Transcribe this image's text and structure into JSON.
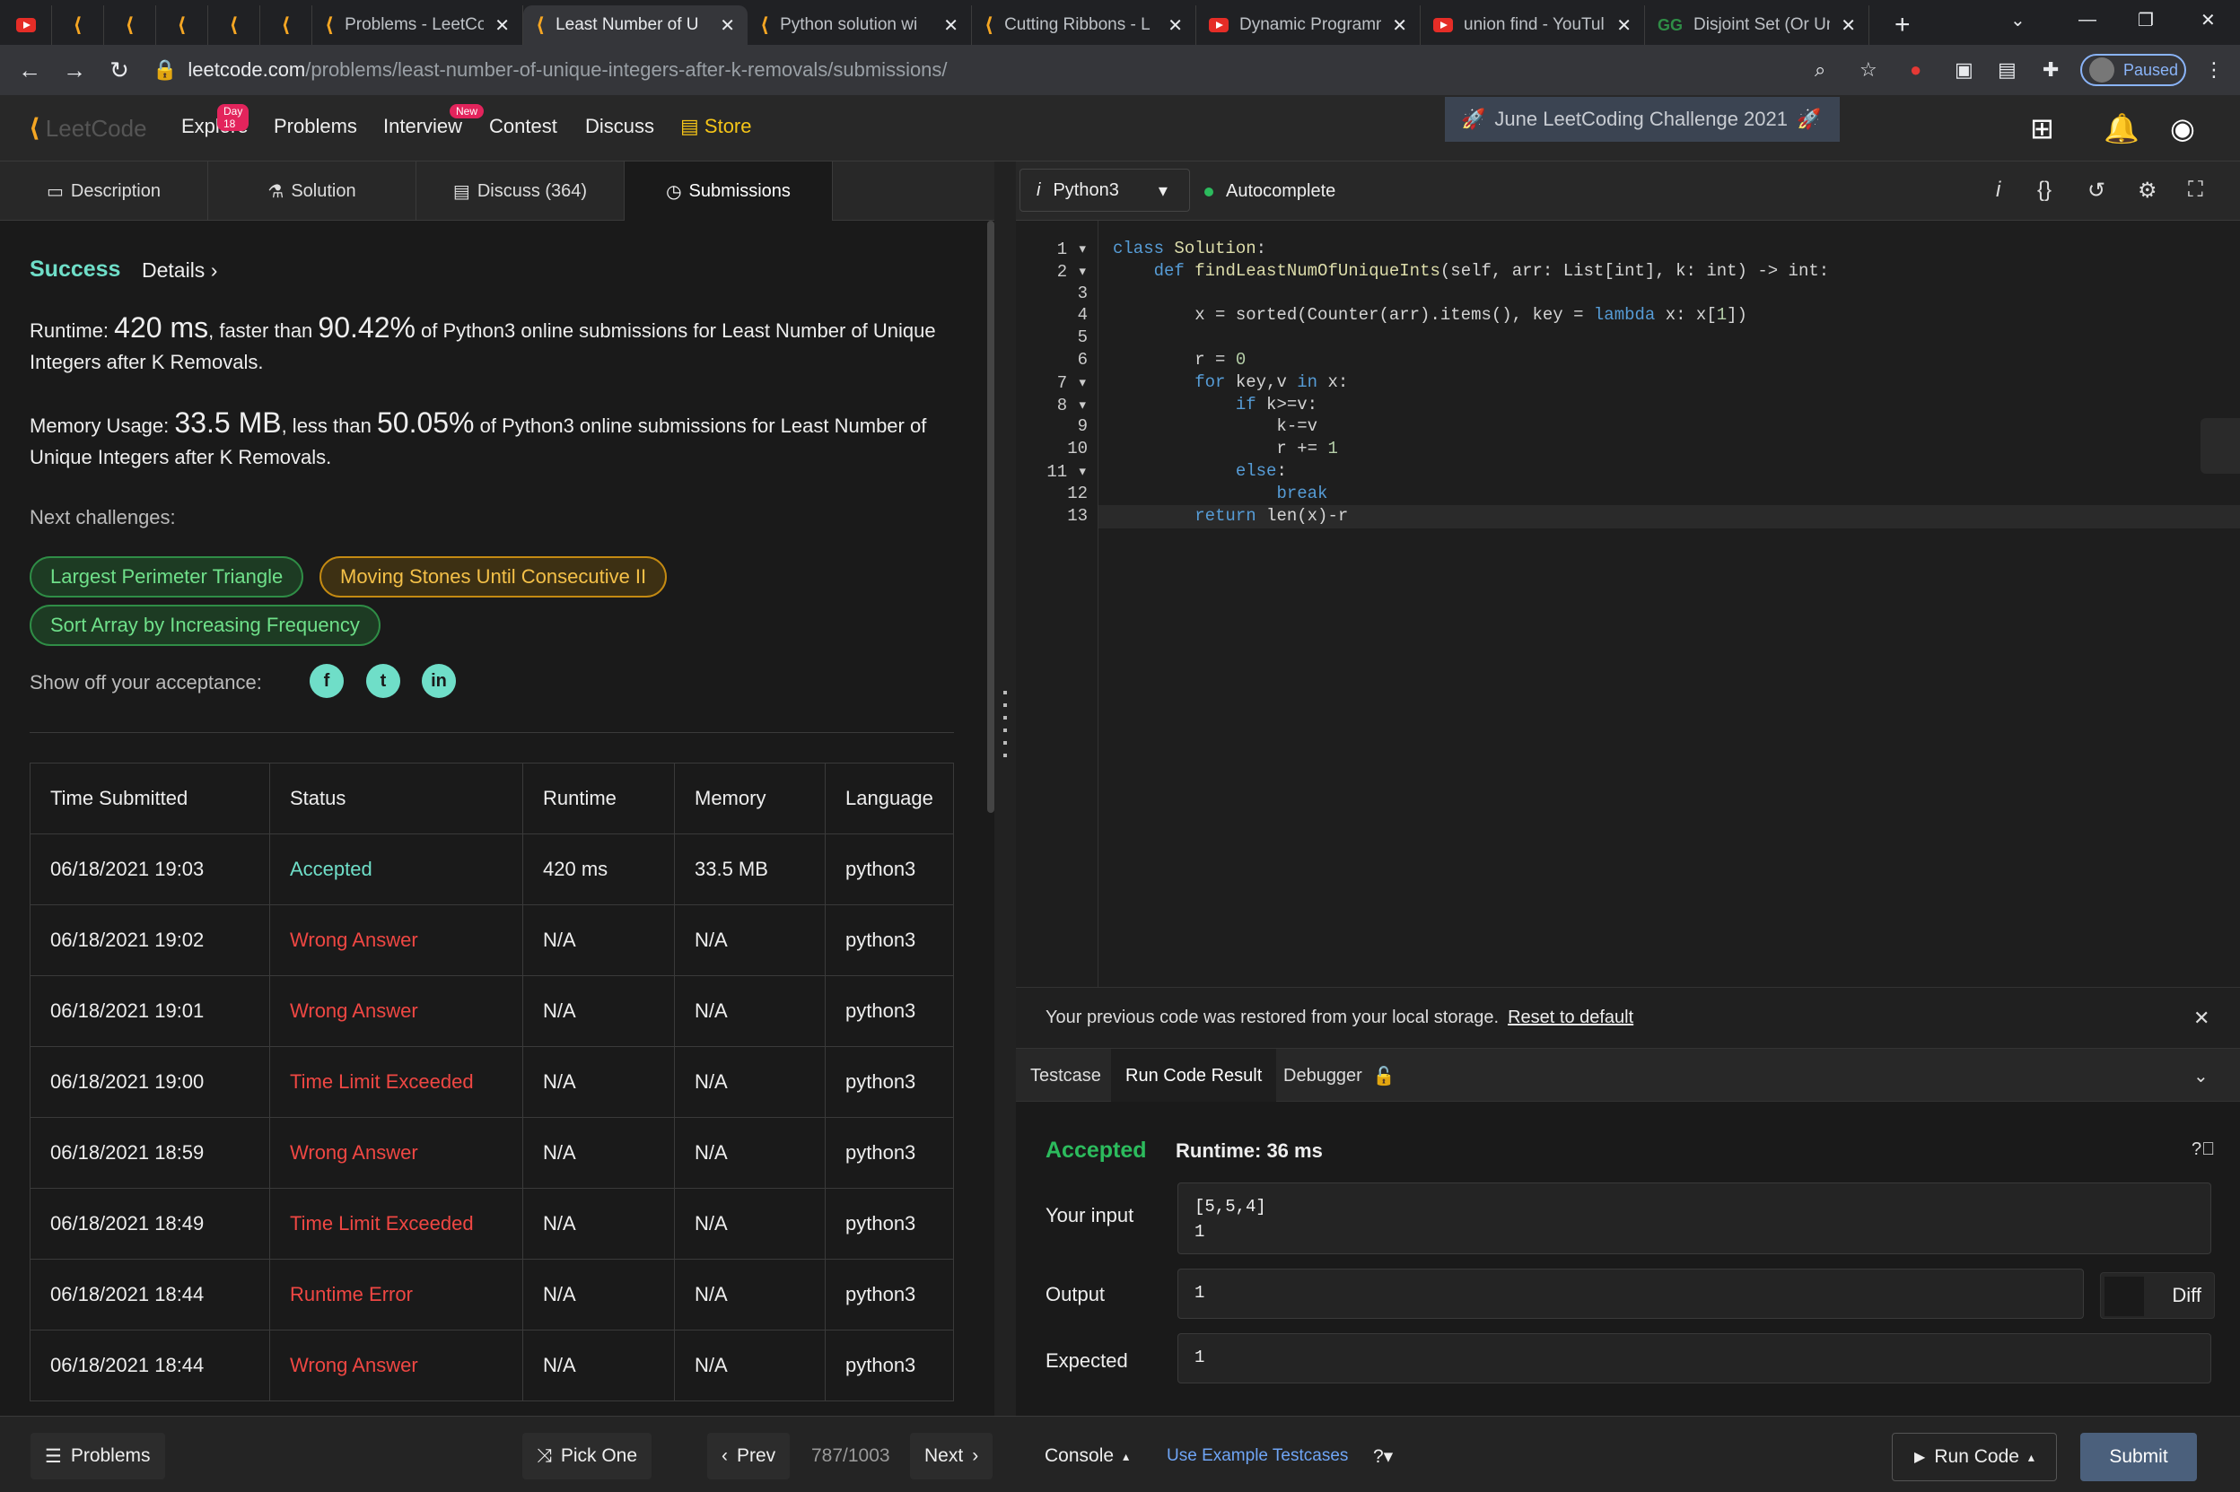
{
  "browser": {
    "tabs": [
      {
        "title": "",
        "favicon": "leetcode-icon"
      },
      {
        "title": "",
        "favicon": "leetcode-icon"
      },
      {
        "title": "",
        "favicon": "leetcode-icon"
      },
      {
        "title": "",
        "favicon": "leetcode-icon"
      },
      {
        "title": "",
        "favicon": "leetcode-icon"
      },
      {
        "title": "Problems - LeetCo",
        "favicon": "leetcode-icon"
      },
      {
        "title": "Least Number of U",
        "favicon": "leetcode-icon",
        "active": true
      },
      {
        "title": "Python solution wi",
        "favicon": "leetcode-icon"
      },
      {
        "title": "Cutting Ribbons - L",
        "favicon": "leetcode-icon"
      },
      {
        "title": "Dynamic Programm",
        "favicon": "youtube-icon"
      },
      {
        "title": "union find - YouTul",
        "favicon": "youtube-icon"
      },
      {
        "title": "Disjoint Set (Or Uni",
        "favicon": "geeksforgeeks-icon"
      }
    ],
    "url_domain": "leetcode.com",
    "url_path": "/problems/least-number-of-unique-integers-after-k-removals/submissions/",
    "profile_status": "Paused"
  },
  "nav": {
    "logo": "LeetCode",
    "explore": "Explore",
    "explore_badge": "Day 18",
    "problems": "Problems",
    "interview": "Interview",
    "interview_badge": "New",
    "contest": "Contest",
    "discuss": "Discuss",
    "store": "Store",
    "challenge": "June LeetCoding Challenge 2021"
  },
  "panel_tabs": {
    "description": "Description",
    "solution": "Solution",
    "discuss": "Discuss (364)",
    "submissions": "Submissions"
  },
  "summary": {
    "status": "Success",
    "details": "Details",
    "runtime_label": "Runtime:",
    "runtime_value": "420 ms",
    "runtime_mid": ", faster than ",
    "runtime_pct": "90.42%",
    "runtime_tail": " of Python3 online submissions for Least Number of Unique Integers after K Removals.",
    "memory_label": "Memory Usage:",
    "memory_value": "33.5 MB",
    "memory_mid": ", less than ",
    "memory_pct": "50.05%",
    "memory_tail": " of Python3 online submissions for Least Number of Unique Integers after K Removals.",
    "next_label": "Next challenges:",
    "challenges": [
      "Largest Perimeter Triangle",
      "Moving Stones Until Consecutive II",
      "Sort Array by Increasing Frequency"
    ],
    "show_off": "Show off your acceptance:"
  },
  "table": {
    "headers": [
      "Time Submitted",
      "Status",
      "Runtime",
      "Memory",
      "Language"
    ],
    "rows": [
      [
        "06/18/2021 19:03",
        "Accepted",
        "420 ms",
        "33.5 MB",
        "python3"
      ],
      [
        "06/18/2021 19:02",
        "Wrong Answer",
        "N/A",
        "N/A",
        "python3"
      ],
      [
        "06/18/2021 19:01",
        "Wrong Answer",
        "N/A",
        "N/A",
        "python3"
      ],
      [
        "06/18/2021 19:00",
        "Time Limit Exceeded",
        "N/A",
        "N/A",
        "python3"
      ],
      [
        "06/18/2021 18:59",
        "Wrong Answer",
        "N/A",
        "N/A",
        "python3"
      ],
      [
        "06/18/2021 18:49",
        "Time Limit Exceeded",
        "N/A",
        "N/A",
        "python3"
      ],
      [
        "06/18/2021 18:44",
        "Runtime Error",
        "N/A",
        "N/A",
        "python3"
      ],
      [
        "06/18/2021 18:44",
        "Wrong Answer",
        "N/A",
        "N/A",
        "python3"
      ]
    ]
  },
  "editor": {
    "language": "Python3",
    "autocomplete": "Autocomplete",
    "code": [
      "class Solution:",
      "    def findLeastNumOfUniqueInts(self, arr: List[int], k: int) -> int:",
      "",
      "        x = sorted(Counter(arr).items(), key = lambda x: x[1])",
      "",
      "        r = 0",
      "        for key,v in x:",
      "            if k>=v:",
      "                k-=v",
      "                r += 1",
      "            else:",
      "                break",
      "        return len(x)-r"
    ]
  },
  "console": {
    "restore_msg": "Your previous code was restored from your local storage.",
    "reset_link": "Reset to default",
    "tab_testcase": "Testcase",
    "tab_result": "Run Code Result",
    "tab_debugger": "Debugger",
    "result_status": "Accepted",
    "result_runtime": "Runtime: 36 ms",
    "input_label": "Your input",
    "input_line1": "[5,5,4]",
    "input_line2": "1",
    "output_label": "Output",
    "output_value": "1",
    "diff": "Diff",
    "expected_label": "Expected",
    "expected_value": "1"
  },
  "bottom": {
    "problems": "Problems",
    "pick_one": "Pick One",
    "prev": "Prev",
    "page": "787/1003",
    "next": "Next",
    "console": "Console",
    "use_example": "Use Example Testcases",
    "run_code": "Run Code",
    "submit": "Submit"
  },
  "colors": {
    "accent": "#6fdec8",
    "error": "#ef4743",
    "accepted": "#2cbb5d",
    "store": "#f5c518"
  }
}
